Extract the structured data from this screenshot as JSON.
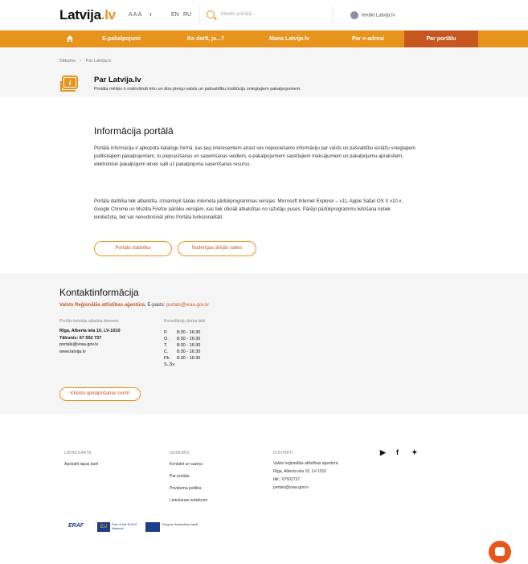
{
  "header": {
    "logo_text": "Latvija",
    "logo_suffix": ".lv",
    "font_size_label": "A A A",
    "contrast_label": "◐",
    "lang_en": "EN",
    "lang_ru": "RU",
    "search_placeholder": "Meklēt portālā...",
    "login_label": "Ienākt Latvija.lv"
  },
  "nav": {
    "items": [
      "E-pakalpojumi",
      "Ko darīt, ja...?",
      "Mana Latvija.lv",
      "Par e-adresi",
      "Par portālu"
    ]
  },
  "breadcrumb": {
    "home": "Sākums",
    "sep": "›",
    "current": "Par Latvija.lv"
  },
  "page": {
    "title": "Par Latvija.lv",
    "subtitle": "Portāla mērķis ir nodrošināt ērtu un ātru pieeju valsts un pašvaldību institūciju sniegtajiem pakalpojumiem."
  },
  "info": {
    "title": "Informācija portālā",
    "para1": "Portālā informācija ir apkopota katalogu formā, kas ļauj interesentiem atrast sev nepieciešamo informāciju par valsts un pašvaldību iestāžu sniegtajiem publiskajiem pakalpojumiem, to pieprasīšanas un saņemšanas veidiem, e-pakalpojumiem saistītajiem maksājumiem un pakalpojumu aprakstiem, elektroniski pakalpojumi ietver saiti uz pakalpojuma saņemšanas resursu.",
    "para2": "Portāla darbība tiek atbalstīta, izmantojot šādas interneta pārlūkprogrammas versijas: Microsoft Internet Explorer – v11, Apple Safari OS X v10.x, Google Chrome un Mozilla Firefox pārlūku versijām, kas tiek oficiāli atbalstītas no ražotāju puses. Pārējo pārlūkprogrammu lietošana netiek ierobežota, bet var nenodrošināt pilnu Portāla funkcionalitāti.",
    "btn_stats": "Portāla statistika",
    "btn_links": "Noderīgas ārējās saites"
  },
  "contact": {
    "title": "Kontaktinformācija",
    "agency": "Valsts Reģionālās attīstības aģentūra",
    "email_prefix": ", E-pasts:",
    "email": "portals@vraa.gov.lv",
    "col1_label": "Portāla lietotāju atbalsta dienests",
    "col1_lines": [
      "Rīga, Alberta iela 10, LV-1010",
      "Tālrunis: 67 502 737",
      "portals@vraa.gov.lv",
      "www.latvija.lv"
    ],
    "col2_label": "Konsultāciju darba laiki",
    "hours": [
      [
        "P.",
        "8:30 - 16:30"
      ],
      [
        "O.",
        "8:30 - 16:30"
      ],
      [
        "T.",
        "8:30 - 16:30"
      ],
      [
        "C.",
        "8:30 - 16:30"
      ],
      [
        "Pk.",
        "8:30 - 16:30"
      ],
      [
        "S.,Sv.",
        ""
      ]
    ],
    "btn_centers": "Klientu apkalpošanas centri"
  },
  "footer": {
    "col1_head": "LAPAS KARTE",
    "col1_items": [
      "Apskatīt lapas karti"
    ],
    "col2_head": "NODERĪGI",
    "col2_items": [
      "Kontakti un saziņa",
      "Par portālu",
      "Privātuma politika",
      "Lietošanas noteikumi"
    ],
    "col3_head": "KONTAKTI",
    "col3_items": [
      "Valsts reģionālās attīstības aģentūra",
      "Rīga, Alberta iela 10, LV-1010",
      "tālr.: 67502737",
      "portals@vraa.gov.lv"
    ],
    "logos": [
      "ERAF",
      "EU",
      "Part of the EUGO Network",
      "Eiropas Savienības fondi"
    ]
  },
  "colors": {
    "accent": "#e8931c",
    "active": "#c6581f",
    "chat": "#e8561c"
  }
}
